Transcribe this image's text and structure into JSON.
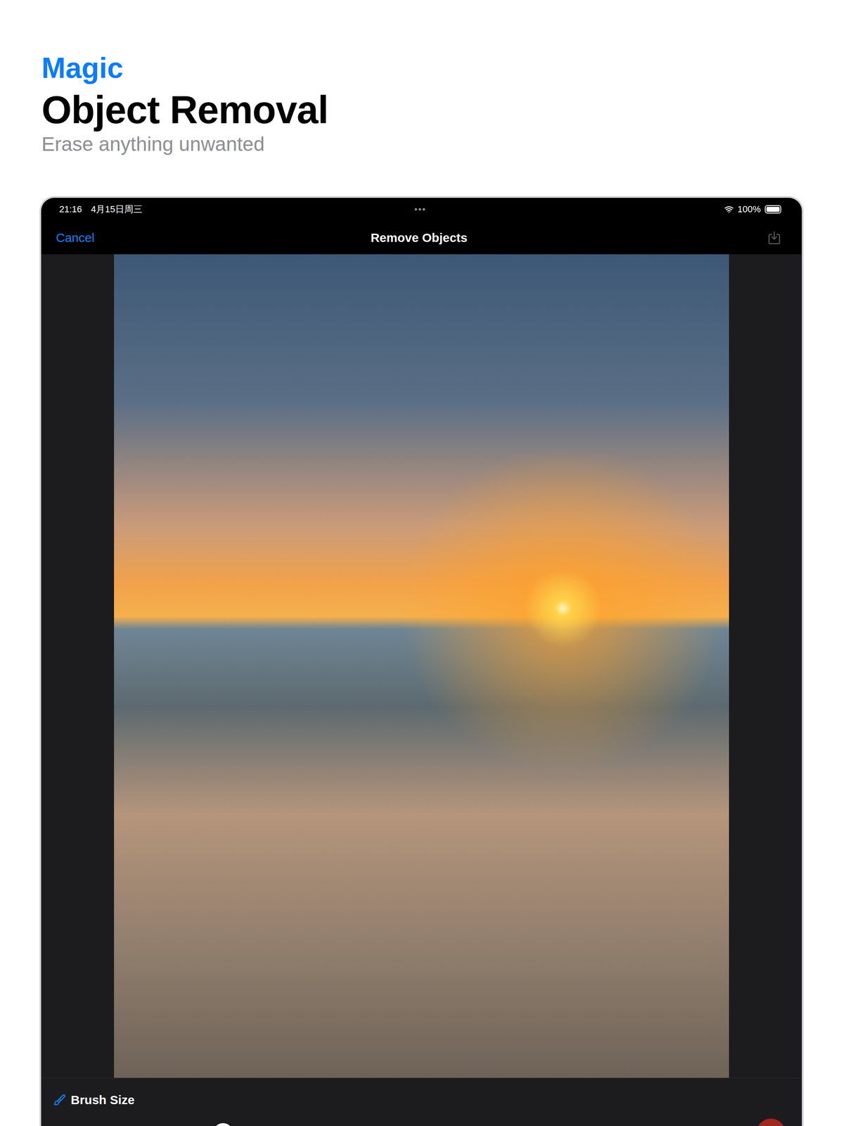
{
  "header": {
    "kicker": "Magic",
    "title": "Object Removal",
    "subtitle": "Erase anything unwanted"
  },
  "status_bar": {
    "time": "21:16",
    "date": "4月15日周三",
    "dots": "•••",
    "battery": "100%",
    "battery_level": 1.0
  },
  "nav": {
    "cancel": "Cancel",
    "title": "Remove Objects",
    "save_enabled": false
  },
  "brush": {
    "label": "Brush Size",
    "level": 0.23
  }
}
